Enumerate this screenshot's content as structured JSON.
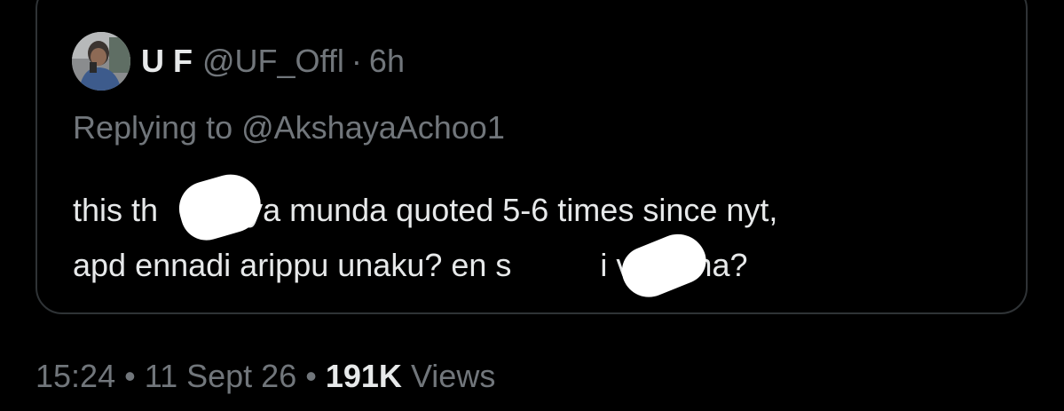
{
  "quoted_tweet": {
    "author": {
      "display_name": "U F",
      "handle": "@UF_Offl",
      "age": "6h",
      "separator": "·"
    },
    "reply_prefix": "Replying to",
    "reply_to": "@AkshayaAchoo1",
    "text_lines": [
      "this th          ya munda quoted 5-6 times since nyt,",
      "apd ennadi arippu unaku? en s          i venuma?"
    ]
  },
  "tweet_meta": {
    "time": "15:24",
    "dot1": "•",
    "date": "11 Sept 26",
    "dot2": "•",
    "views_count": "191K",
    "views_label": "Views"
  },
  "colors": {
    "background": "#000000",
    "primary_text": "#e7e9ea",
    "secondary_text": "#71767b",
    "border": "#2f3336",
    "redaction": "#ffffff"
  }
}
